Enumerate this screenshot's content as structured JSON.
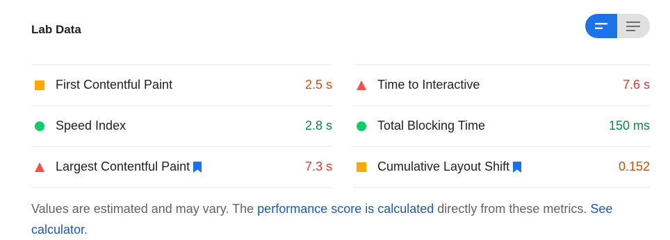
{
  "header": {
    "title": "Lab Data"
  },
  "colors": {
    "fail": "#e8372b",
    "average": "#d24e0b",
    "pass": "#0c8a3e",
    "orange_marker": "#fbab00",
    "green_marker": "#0cce6b",
    "red_marker": "#ff4e42",
    "accent": "#1a73e8"
  },
  "metrics": {
    "left": [
      {
        "label": "First Contentful Paint",
        "value": "2.5 s",
        "status": "average",
        "icon": "orange-square",
        "bookmark": false
      },
      {
        "label": "Speed Index",
        "value": "2.8 s",
        "status": "pass",
        "icon": "green-circle",
        "bookmark": false
      },
      {
        "label": "Largest Contentful Paint",
        "value": "7.3 s",
        "status": "fail",
        "icon": "red-triangle",
        "bookmark": true
      }
    ],
    "right": [
      {
        "label": "Time to Interactive",
        "value": "7.6 s",
        "status": "fail",
        "icon": "red-triangle",
        "bookmark": false
      },
      {
        "label": "Total Blocking Time",
        "value": "150 ms",
        "status": "pass",
        "icon": "green-circle",
        "bookmark": false
      },
      {
        "label": "Cumulative Layout Shift",
        "value": "0.152",
        "status": "average",
        "icon": "orange-square",
        "bookmark": true
      }
    ]
  },
  "footer": {
    "text_1": "Values are estimated and may vary. The ",
    "link_1": "performance score is calculated",
    "text_2": " directly from these metrics. ",
    "link_2": "See calculator",
    "text_3": "."
  }
}
